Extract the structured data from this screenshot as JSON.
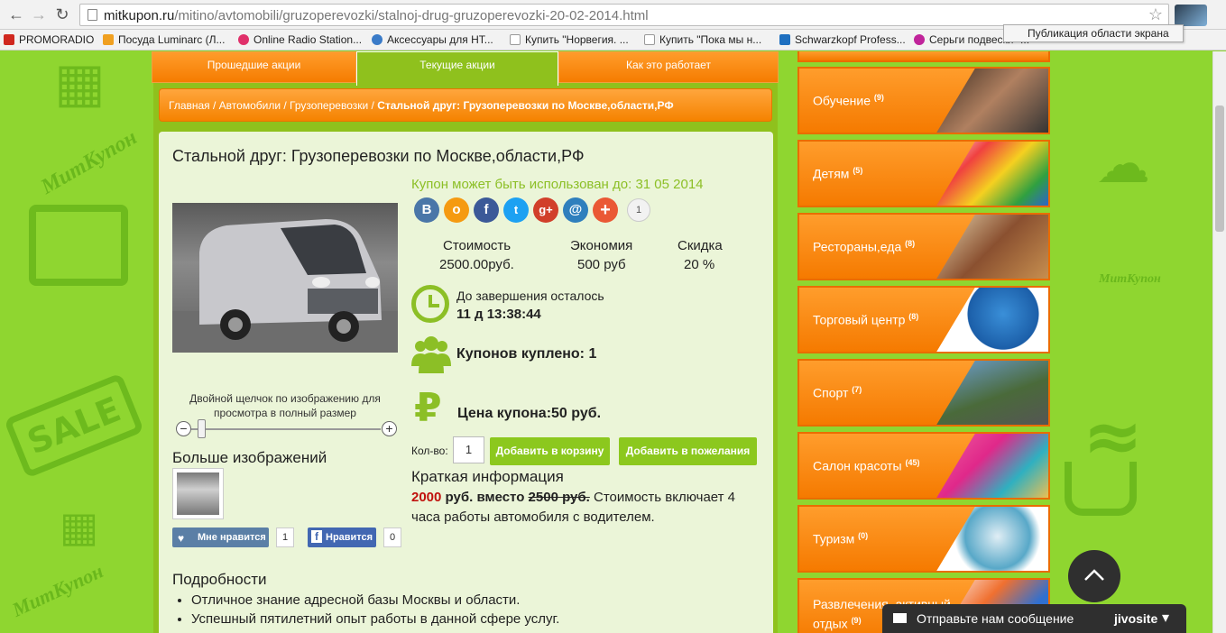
{
  "browser": {
    "url_host": "mitkupon.ru",
    "url_path": "/mitino/avtomobili/gruzoperevozki/stalnoj-drug-gruzoperevozki-20-02-2014.html",
    "tooltip": "Публикация области экрана",
    "bookmarks": [
      {
        "label": "PROMORADIO",
        "color": "#d0281f"
      },
      {
        "label": "Посуда Luminarc (Л...",
        "color": "#f0a020"
      },
      {
        "label": "Online Radio Station...",
        "color": "#e0306a"
      },
      {
        "label": "Аксессуары для НТ...",
        "color": "#3a7bc8"
      },
      {
        "label": "Купить \"Норвегия. ...",
        "color": "#dddddd"
      },
      {
        "label": "Купить \"Пока мы н...",
        "color": "#dddddd"
      },
      {
        "label": "Schwarzkopf Profess...",
        "color": "#1f70c0"
      },
      {
        "label": "Серьги подвески \"...",
        "color": "#c0239a"
      }
    ]
  },
  "tabs": [
    "Прошедшие акции",
    "Текущие акции",
    "Как это работает"
  ],
  "breadcrumb": {
    "path": "Главная / Автомобили / Грузоперевозки / ",
    "current": "Стальной друг: Грузоперевозки по Москве,области,РФ"
  },
  "deal": {
    "title": "Стальной друг: Грузоперевозки по Москве,области,РФ",
    "valid_until": "Купон может быть использован до: 31 05 2014",
    "share_count": "1",
    "stats": {
      "cost_label": "Стоимость",
      "cost_value": "2500.00руб.",
      "saving_label": "Экономия",
      "saving_value": "500 руб",
      "discount_label": "Скидка",
      "discount_value": "20 %"
    },
    "remain_label": "До завершения осталось",
    "remain_value": "11 д 13:38:44",
    "bought": "Купонов куплено: 1",
    "coupon_price": "Цена купона:50 руб.",
    "qty_label": "Кол-во:",
    "qty_value": "1",
    "add_to_cart": "Добавить в корзину",
    "add_to_wishlist": "Добавить в пожелания",
    "brief_heading": "Краткая информация",
    "brief_new_price": "2000",
    "brief_mid": " руб.  вместо ",
    "brief_old_price": "2500 руб.",
    "brief_rest": " Стоимость включает 4 часа работы автомобиля с водителем.",
    "zoom_hint": "Двойной щелчок по изображению для просмотра в полный размер",
    "more_images": "Больше изображений",
    "like_vk_label": "Мне нравится",
    "like_vk_count": "1",
    "like_fb_label": "Нравится",
    "like_fb_count": "0",
    "details_heading": "Подробности",
    "details": [
      "Отличное знание адресной базы Москвы и области.",
      "Успешный пятилетний опыт работы в данной сфере услуг."
    ]
  },
  "categories": [
    {
      "label": "Обучение",
      "count": "(9)"
    },
    {
      "label": "Детям",
      "count": "(5)"
    },
    {
      "label": "Рестораны,еда",
      "count": "(8)"
    },
    {
      "label": "Торговый центр",
      "count": "(8)"
    },
    {
      "label": "Спорт",
      "count": "(7)"
    },
    {
      "label": "Салон красоты",
      "count": "(45)"
    },
    {
      "label": "Туризм",
      "count": "(0)"
    },
    {
      "label": "Развлечения, активный отдых",
      "count": "(9)"
    }
  ],
  "chat": {
    "label": "Отправьте нам сообщение",
    "brand": "jivosite"
  },
  "background": {
    "watermark": "МитКупон",
    "sale": "SALE"
  }
}
